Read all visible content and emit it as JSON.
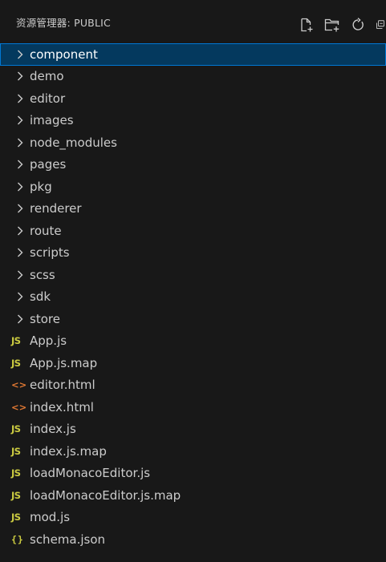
{
  "header": {
    "title": "资源管理器: PUBLIC",
    "actions": [
      {
        "name": "new-file-icon"
      },
      {
        "name": "new-folder-icon"
      },
      {
        "name": "refresh-icon"
      },
      {
        "name": "collapse-all-icon"
      }
    ]
  },
  "colors": {
    "background": "#181818",
    "selection_bg": "#04395e",
    "selection_border": "#0078d4",
    "js_icon": "#cbcb41",
    "html_icon": "#e37933",
    "json_icon": "#cbcb41"
  },
  "tree": {
    "folders": [
      {
        "label": "component",
        "selected": true
      },
      {
        "label": "demo"
      },
      {
        "label": "editor"
      },
      {
        "label": "images"
      },
      {
        "label": "node_modules"
      },
      {
        "label": "pages"
      },
      {
        "label": "pkg"
      },
      {
        "label": "renderer"
      },
      {
        "label": "route"
      },
      {
        "label": "scripts"
      },
      {
        "label": "scss"
      },
      {
        "label": "sdk"
      },
      {
        "label": "store"
      }
    ],
    "files": [
      {
        "label": "App.js",
        "icon": "JS",
        "kind": "js"
      },
      {
        "label": "App.js.map",
        "icon": "JS",
        "kind": "js"
      },
      {
        "label": "editor.html",
        "icon": "<>",
        "kind": "html"
      },
      {
        "label": "index.html",
        "icon": "<>",
        "kind": "html"
      },
      {
        "label": "index.js",
        "icon": "JS",
        "kind": "js"
      },
      {
        "label": "index.js.map",
        "icon": "JS",
        "kind": "js"
      },
      {
        "label": "loadMonacoEditor.js",
        "icon": "JS",
        "kind": "js"
      },
      {
        "label": "loadMonacoEditor.js.map",
        "icon": "JS",
        "kind": "js"
      },
      {
        "label": "mod.js",
        "icon": "JS",
        "kind": "js"
      },
      {
        "label": "schema.json",
        "icon": "{}",
        "kind": "json"
      }
    ]
  }
}
